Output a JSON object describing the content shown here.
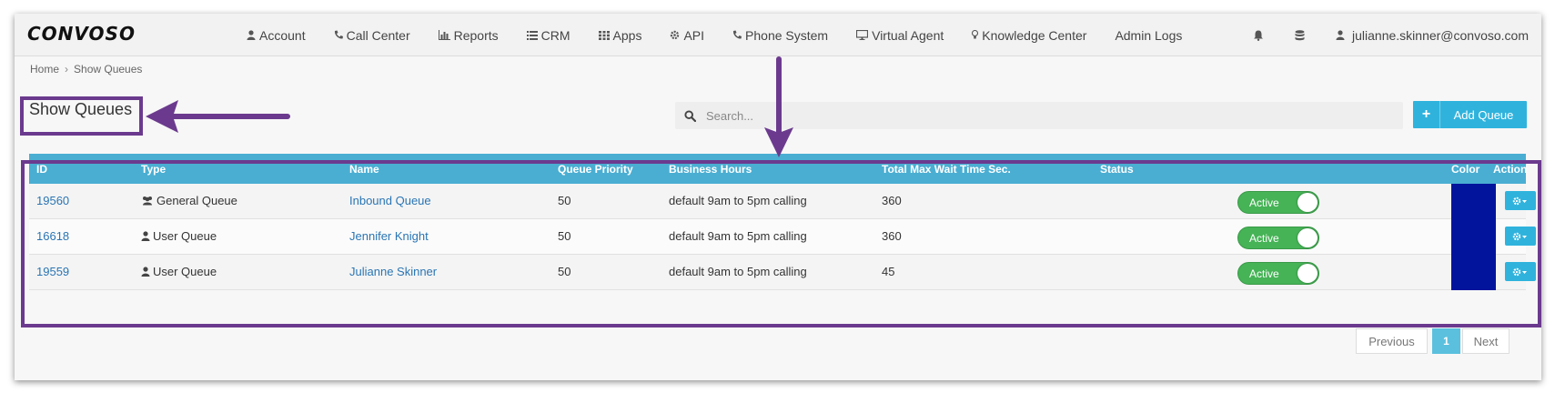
{
  "brand": {
    "logo_text": "CONVOSO"
  },
  "nav": {
    "items": [
      {
        "label": "Account",
        "icon": "user-icon"
      },
      {
        "label": "Call Center",
        "icon": "phone-icon"
      },
      {
        "label": "Reports",
        "icon": "bar-chart-icon"
      },
      {
        "label": "CRM",
        "icon": "list-icon"
      },
      {
        "label": "Apps",
        "icon": "grid-icon"
      },
      {
        "label": "API",
        "icon": "gear-icon"
      },
      {
        "label": "Phone System",
        "icon": "phone-icon"
      },
      {
        "label": "Virtual Agent",
        "icon": "monitor-icon"
      },
      {
        "label": "Knowledge Center",
        "icon": "lightbulb-icon"
      },
      {
        "label": "Admin Logs",
        "icon": ""
      }
    ],
    "user_email": "julianne.skinner@convoso.com"
  },
  "breadcrumb": {
    "home": "Home",
    "separator": "›",
    "current": "Show Queues"
  },
  "page": {
    "title": "Show Queues",
    "search_placeholder": "Search...",
    "add_button_label": "Add Queue"
  },
  "table": {
    "columns": [
      "ID",
      "Type",
      "Name",
      "Queue Priority",
      "Business Hours",
      "Total Max Wait Time Sec.",
      "Status",
      "Color",
      "Action"
    ],
    "rows": [
      {
        "id": "19560",
        "type": "General Queue",
        "type_icon": "users-icon",
        "name": "Inbound Queue",
        "priority": "50",
        "hours": "default 9am to 5pm calling",
        "max_wait": "360",
        "status": "Active",
        "color": "#02149c"
      },
      {
        "id": "16618",
        "type": "User Queue",
        "type_icon": "user-icon",
        "name": "Jennifer Knight",
        "priority": "50",
        "hours": "default 9am to 5pm calling",
        "max_wait": "360",
        "status": "Active",
        "color": "#02149c"
      },
      {
        "id": "19559",
        "type": "User Queue",
        "type_icon": "user-icon",
        "name": "Julianne Skinner",
        "priority": "50",
        "hours": "default 9am to 5pm calling",
        "max_wait": "45",
        "status": "Active",
        "color": "#02149c"
      }
    ]
  },
  "pagination": {
    "previous": "Previous",
    "current": "1",
    "next": "Next"
  },
  "colors": {
    "header_blue": "#4aaed2",
    "accent_blue": "#2fb3dd",
    "status_green": "#45b356",
    "annotation_purple": "#6b3a8e",
    "link_blue": "#2a75b3"
  }
}
